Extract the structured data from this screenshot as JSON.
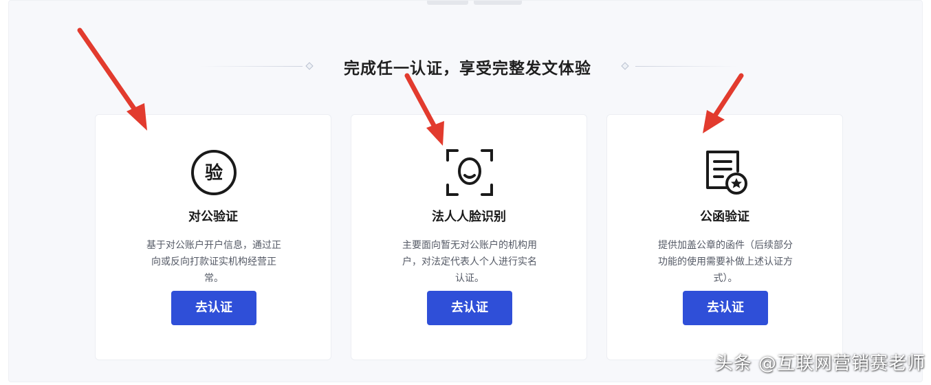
{
  "heading": "完成任一认证，享受完整发文体验",
  "accent_color": "#2f4fd8",
  "arrow_color": "#e23b2e",
  "cards": [
    {
      "icon": "seal-verify-icon",
      "icon_text": "验",
      "title": "对公验证",
      "desc_lines": [
        "基于对公账户开户信息，通过正",
        "向或反向打款证实机构经营正",
        "常。"
      ],
      "button": "去认证"
    },
    {
      "icon": "face-scan-icon",
      "title": "法人人脸识别",
      "desc_lines": [
        "主要面向暂无对公账户的机构用",
        "户，对法定代表人个人进行实名",
        "认证。"
      ],
      "button": "去认证"
    },
    {
      "icon": "official-letter-icon",
      "title": "公函验证",
      "desc_lines": [
        "提供加盖公章的函件（后续部分",
        "功能的使用需要补做上述认证方",
        "式）。"
      ],
      "button": "去认证"
    }
  ],
  "watermark": "头条 @互联网营销赛老师"
}
